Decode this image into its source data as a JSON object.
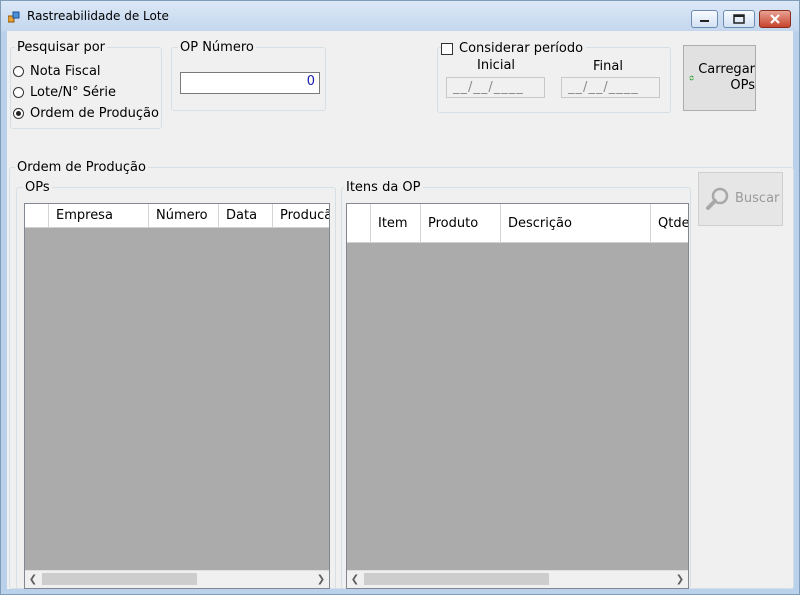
{
  "window": {
    "title": "Rastreabilidade de Lote"
  },
  "search_by": {
    "legend": "Pesquisar por",
    "options": [
      {
        "label": "Nota Fiscal",
        "checked": false
      },
      {
        "label": "Lote/N° Série",
        "checked": false
      },
      {
        "label": "Ordem de Produção",
        "checked": true
      }
    ]
  },
  "op_number": {
    "legend": "OP Número",
    "value": "0"
  },
  "period": {
    "checkbox_label": "Considerar período",
    "checked": false,
    "start_label": "Inicial",
    "end_label": "Final",
    "start_value": "__/__/____",
    "end_value": "__/__/____"
  },
  "load_button": {
    "label_line1": "Carregar",
    "label_line2": "OPs",
    "icon": "refresh-arrows-icon"
  },
  "search_button": {
    "label": "Buscar",
    "icon": "magnifier-icon",
    "enabled": false
  },
  "production_order": {
    "legend": "Ordem de Produção",
    "ops": {
      "legend": "OPs",
      "columns": [
        "Empresa",
        "Número",
        "Data",
        "Producã"
      ],
      "rows": []
    },
    "items": {
      "legend": "Itens da OP",
      "columns": [
        "Item",
        "Produto",
        "Descrição",
        "Qtde."
      ],
      "rows": []
    }
  },
  "colors": {
    "grid_background": "#ababab",
    "window_frame": "#b9d1ea",
    "client_background": "#f0f0f0",
    "close_button": "#c7432c"
  }
}
